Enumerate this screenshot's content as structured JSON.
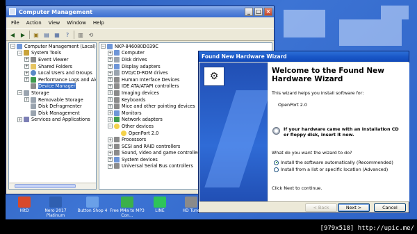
{
  "cm": {
    "title": "Computer Management",
    "menu": [
      "File",
      "Action",
      "View",
      "Window",
      "Help"
    ],
    "left_tree": [
      {
        "exp": "minus",
        "icon": "comp",
        "label": "Computer Management (Local)",
        "indent": 0
      },
      {
        "exp": "minus",
        "icon": "tool",
        "label": "System Tools",
        "indent": 1
      },
      {
        "exp": "plus",
        "icon": "dev",
        "label": "Event Viewer",
        "indent": 2
      },
      {
        "exp": "plus",
        "icon": "folder",
        "label": "Shared Folders",
        "indent": 2
      },
      {
        "exp": "plus",
        "icon": "users",
        "label": "Local Users and Groups",
        "indent": 2
      },
      {
        "exp": "plus",
        "icon": "perf",
        "label": "Performance Logs and Alerts",
        "indent": 2
      },
      {
        "exp": "none",
        "icon": "dev",
        "label": "Device Manager",
        "indent": 2,
        "selected": true
      },
      {
        "exp": "minus",
        "icon": "disk",
        "label": "Storage",
        "indent": 1
      },
      {
        "exp": "plus",
        "icon": "disk",
        "label": "Removable Storage",
        "indent": 2
      },
      {
        "exp": "none",
        "icon": "disk",
        "label": "Disk Defragmenter",
        "indent": 2
      },
      {
        "exp": "none",
        "icon": "disk",
        "label": "Disk Management",
        "indent": 2
      },
      {
        "exp": "plus",
        "icon": "svc",
        "label": "Services and Applications",
        "indent": 1
      }
    ],
    "right_tree": [
      {
        "exp": "minus",
        "icon": "comp",
        "label": "NKP-846080D039C",
        "indent": 0
      },
      {
        "exp": "plus",
        "icon": "comp",
        "label": "Computer",
        "indent": 1
      },
      {
        "exp": "plus",
        "icon": "disk",
        "label": "Disk drives",
        "indent": 1
      },
      {
        "exp": "plus",
        "icon": "comp",
        "label": "Display adapters",
        "indent": 1
      },
      {
        "exp": "plus",
        "icon": "disk",
        "label": "DVD/CD-ROM drives",
        "indent": 1
      },
      {
        "exp": "plus",
        "icon": "dev",
        "label": "Human Interface Devices",
        "indent": 1
      },
      {
        "exp": "plus",
        "icon": "dev",
        "label": "IDE ATA/ATAPI controllers",
        "indent": 1
      },
      {
        "exp": "plus",
        "icon": "dev",
        "label": "Imaging devices",
        "indent": 1
      },
      {
        "exp": "plus",
        "icon": "dev",
        "label": "Keyboards",
        "indent": 1
      },
      {
        "exp": "plus",
        "icon": "dev",
        "label": "Mice and other pointing devices",
        "indent": 1
      },
      {
        "exp": "plus",
        "icon": "comp",
        "label": "Monitors",
        "indent": 1
      },
      {
        "exp": "plus",
        "icon": "perf",
        "label": "Network adapters",
        "indent": 1
      },
      {
        "exp": "minus",
        "icon": "warn",
        "label": "Other devices",
        "indent": 1
      },
      {
        "exp": "none",
        "icon": "warn",
        "label": "OpenPort 2.0",
        "indent": 2
      },
      {
        "exp": "plus",
        "icon": "dev",
        "label": "Processors",
        "indent": 1
      },
      {
        "exp": "plus",
        "icon": "dev",
        "label": "SCSI and RAID controllers",
        "indent": 1
      },
      {
        "exp": "plus",
        "icon": "dev",
        "label": "Sound, video and game controllers",
        "indent": 1
      },
      {
        "exp": "plus",
        "icon": "comp",
        "label": "System devices",
        "indent": 1
      },
      {
        "exp": "plus",
        "icon": "dev",
        "label": "Universal Serial Bus controllers",
        "indent": 1
      }
    ]
  },
  "wizard": {
    "title": "Found New Hardware Wizard",
    "heading": "Welcome to the Found New Hardware Wizard",
    "intro": "This wizard helps you install software for:",
    "device": "OpenPort 2.0",
    "cd_line1": "If your hardware came with an installation CD",
    "cd_line2": "or floppy disk, insert it now.",
    "question": "What do you want the wizard to do?",
    "option1": "Install the software automatically (Recommended)",
    "option2": "Install from a list or specific location (Advanced)",
    "continue": "Click Next to continue.",
    "back": "< Back",
    "next": "Next >",
    "cancel": "Cancel"
  },
  "desktop_icons": [
    {
      "label": "HitD",
      "color": "#d8492a"
    },
    {
      "label": "Nero 2017 Platinum",
      "color": "#2f5fb0"
    },
    {
      "label": "Button Shop 4",
      "color": "#6aa0e8"
    },
    {
      "label": "Free M4a to MP3 Con...",
      "color": "#3bb04a"
    },
    {
      "label": "LINE",
      "color": "#2ec45a"
    },
    {
      "label": "HD Tune",
      "color": "#8a8a8a"
    }
  ],
  "credit": "[979x518] http://upic.me/"
}
